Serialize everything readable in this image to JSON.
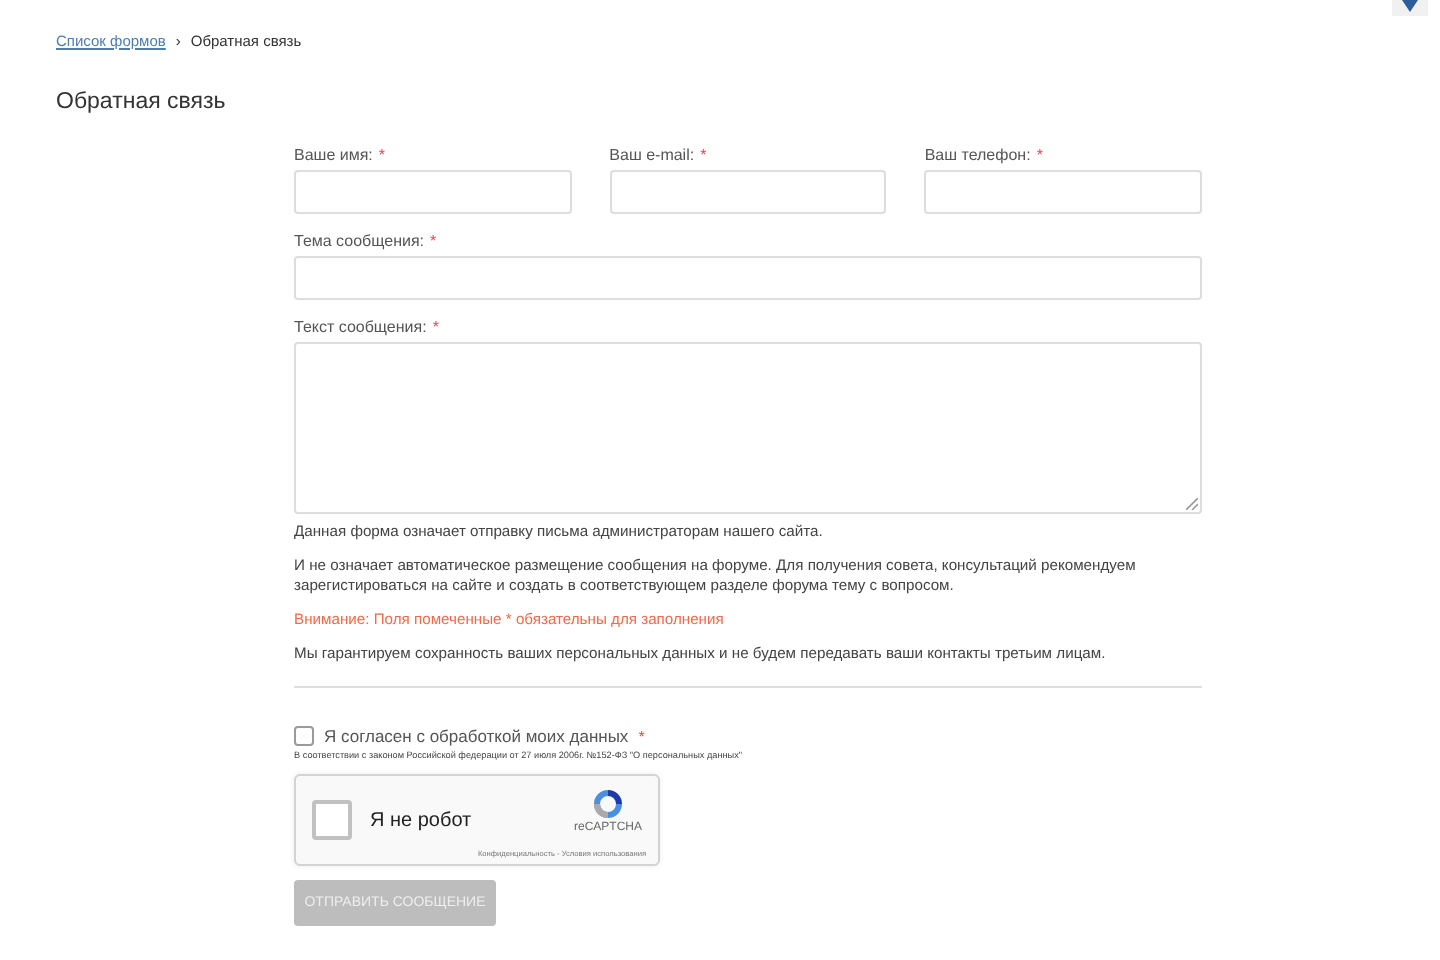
{
  "breadcrumb": {
    "link": "Список формов",
    "separator": "›",
    "current": "Обратная связь"
  },
  "title": "Обратная связь",
  "fields": [
    {
      "label": "Ваше имя:",
      "mark": "*",
      "kind": "input"
    },
    {
      "label": "Ваш e-mail:",
      "mark": "*",
      "kind": "input"
    },
    {
      "label": "Ваш телефон:",
      "mark": "*",
      "kind": "input"
    },
    {
      "label": "Тема сообщения:",
      "mark": "*",
      "kind": "input"
    },
    {
      "label": "Текст сообщения:",
      "mark": "*",
      "kind": "textarea"
    }
  ],
  "notes": [
    {
      "text": "Данная форма означает отправку письма администраторам нашего сайта.",
      "kind": "plain"
    },
    {
      "text": "И не означает автоматическое размещение сообщения на форуме. Для получения совета, консультаций рекомендуем зарегистироваться на сайте и создать в соответствующем разделе форума тему с вопросом.",
      "kind": "plain"
    },
    {
      "text": "Внимание: Поля помеченные * обязательны для заполнения",
      "kind": "warning"
    },
    {
      "text": "Мы гарантируем сохранность ваших персональных данных и не будем передавать ваши контакты третьим лицам.",
      "kind": "plain"
    }
  ],
  "consent": {
    "label": "Я согласен с обработкой моих данных",
    "mark": "*",
    "checked": false,
    "law": "В соответствии с законом Российской федерации от 27 июля 2006г. №152-ФЗ \"О персональных данных\""
  },
  "captcha": {
    "label": "Я не робот",
    "checked": false,
    "brand": "reCAPTCHA",
    "links": "Конфиденциальность - Условия использования"
  },
  "submit": {
    "label": "ОТПРАВИТЬ СООБЩЕНИЕ",
    "disabled": true
  }
}
